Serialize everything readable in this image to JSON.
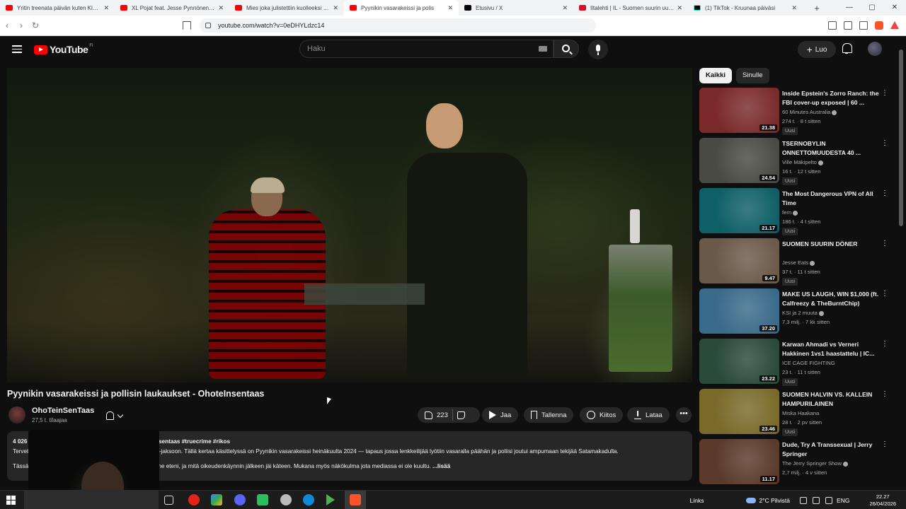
{
  "browser": {
    "tabs": [
      {
        "title": "Yritin treenata päivän kuten Klesbo -",
        "icon": "youtube-favicon",
        "active": false
      },
      {
        "title": "XL Pojat feat. Jesse Pynnönen - You",
        "icon": "youtube-favicon",
        "active": false
      },
      {
        "title": "Mies joka julistettiin kuolleeksi – mm",
        "icon": "youtube-favicon",
        "active": false
      },
      {
        "title": "Pyynikin vasarakeissi ja polis",
        "icon": "youtube-favicon",
        "active": true
      },
      {
        "title": "Etusivu / X",
        "icon": "x-favicon",
        "active": false
      },
      {
        "title": "Iltalehti | IL - Suomen suurin uutispa",
        "icon": "iltalehti-favicon",
        "active": false
      },
      {
        "title": "(1) TikTok - Kruunaa päiväsi",
        "icon": "tiktok-favicon",
        "active": false
      }
    ],
    "url": "youtube.com/watch?v=0eDHYLdzc14"
  },
  "header": {
    "logo_text": "YouTube",
    "logo_region": "FI",
    "search_placeholder": "Haku",
    "create_label": "Luo"
  },
  "video": {
    "title": "Pyynikin vasarakeissi ja pollisin laukaukset - OhoteInsentaas",
    "channel_name": "OhoTeinSenTaas",
    "subscribers": "27,5 t. tilaajaa",
    "likes": "223",
    "share_label": "Jaa",
    "save_label": "Tallenna",
    "thanks_label": "Kiitos",
    "download_label": "Lataa"
  },
  "description": {
    "line1_left": "4 026 katsel",
    "line1_right": "sentaas #truecrime #rikos",
    "line2_left": "Tervetulo",
    "line2_right": "ortti-jaksoon. Tällä kertaa käsittelyssä on Pyynikin vasarakeissi heinäkuulta 2024 — tapaus jossa lenkkeilijää lyötiin vasaralla päähän ja poliisi joutui ampumaan tekijää Satamakadulla.",
    "line3_left": "Tässä j",
    "line3_right": "lanne eteni, ja mitä oikeudenkäynnin jälkeen jäi käteen. Mukana myös näkökulma jota mediassa ei ole kuultu.",
    "more_label": "...lisää"
  },
  "sidebar": {
    "chips": [
      {
        "label": "Kaikki",
        "active": true
      },
      {
        "label": "Sinulle",
        "active": false
      }
    ],
    "recommendations": [
      {
        "title": "Inside Epstein's Zorro Ranch: the FBI cover-up exposed | 60 ...",
        "channel": "60 Minutes Australia",
        "verified": true,
        "meta": "274 t. · 8 t sitten",
        "badge": "Uusi",
        "duration": "21.38",
        "thumb_color": "#7a2a2a"
      },
      {
        "title": "TSERNOBYLIN ONNETTOMUUDESTA 40 ...",
        "channel": "Ville Mäkipelto",
        "verified": true,
        "meta": "16 t. · 12 t sitten",
        "badge": "Uusi",
        "duration": "24.54",
        "thumb_color": "#4a4a44"
      },
      {
        "title": "The Most Dangerous VPN of All Time",
        "channel": "fern",
        "verified": true,
        "meta": "186 t. · 4 t sitten",
        "badge": "Uusi",
        "duration": "21.17",
        "thumb_color": "#0f5f66"
      },
      {
        "title": "SUOMEN SUURIN DÖNER",
        "channel": "Jesse Eats",
        "verified": true,
        "meta": "37 t. · 11 t sitten",
        "badge": "Uusi",
        "duration": "9.47",
        "thumb_color": "#6a5a4a"
      },
      {
        "title": "MAKE US LAUGH, WIN $1,000 (ft. Calfreezy & TheBurntChip)",
        "channel": "KSI ja 2 muuta",
        "verified": true,
        "meta": "7,3 milj. · 7 kk sitten",
        "badge": "",
        "duration": "37.20",
        "thumb_color": "#3a6a8a"
      },
      {
        "title": "Karwan Ahmadi vs Verneri Hakkinen 1vs1 haastattelu | IC...",
        "channel": "ICE CAGE FIGHTING",
        "verified": false,
        "meta": "23 t. · 11 t sitten",
        "badge": "Uusi",
        "duration": "23.22",
        "thumb_color": "#2a4a3a"
      },
      {
        "title": "SUOMEN HALVIN VS. KALLEIN HAMPURILAINEN",
        "channel": "Miska Haakana",
        "verified": false,
        "meta": "28 t. · 2 pv sitten",
        "badge": "Uusi",
        "duration": "23.46",
        "thumb_color": "#7a6a2a"
      },
      {
        "title": "Dude, Try A Transsexual | Jerry Springer",
        "channel": "The Jerry Springer Show",
        "verified": true,
        "meta": "2,7 milj. · 4 v sitten",
        "badge": "",
        "duration": "11.17",
        "thumb_color": "#5a3a2a"
      }
    ]
  },
  "taskbar": {
    "links_label": "Links",
    "weather": "2°C Pilvistä",
    "lang": "ENG",
    "time": "22.27",
    "date": "26/04/2026"
  }
}
